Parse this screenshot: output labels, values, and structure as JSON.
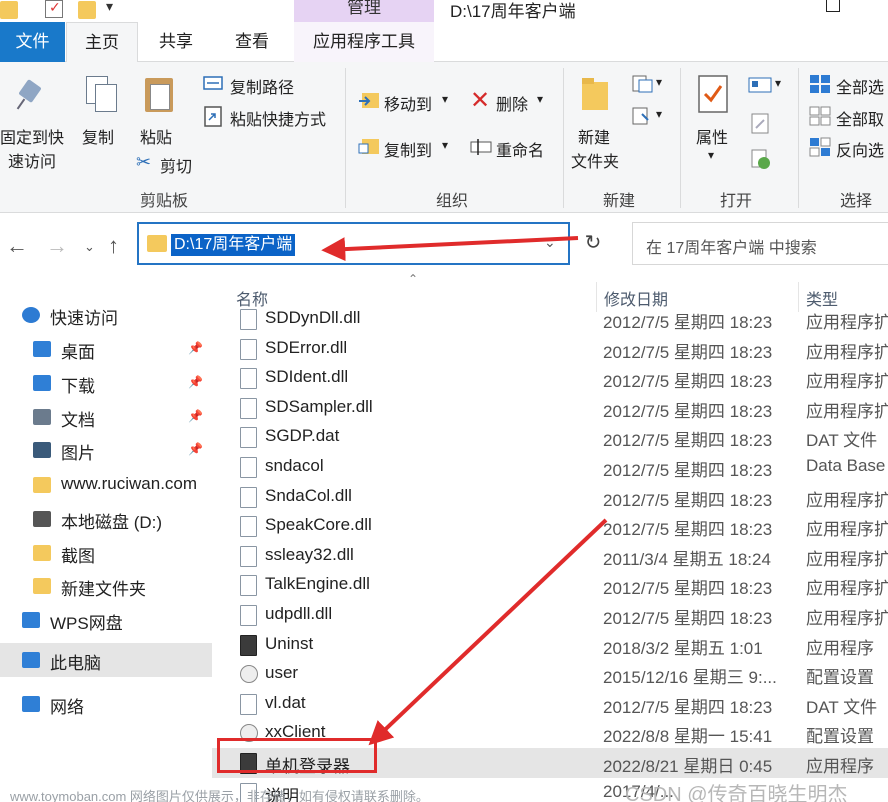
{
  "titlebar": {
    "manage_tab": "管理",
    "path_title": "D:\\17周年客户端"
  },
  "tabs": {
    "file": "文件",
    "home": "主页",
    "share": "共享",
    "view": "查看",
    "app_tools": "应用程序工具"
  },
  "ribbon": {
    "pin_line1": "固定到快",
    "pin_line2": "速访问",
    "copy": "复制",
    "paste": "粘贴",
    "copy_path": "复制路径",
    "paste_shortcut": "粘贴快捷方式",
    "cut": "剪切",
    "group_clipboard": "剪贴板",
    "move_to": "移动到",
    "copy_to": "复制到",
    "delete": "删除",
    "rename": "重命名",
    "group_organize": "组织",
    "new_folder_line1": "新建",
    "new_folder_line2": "文件夹",
    "group_new": "新建",
    "properties": "属性",
    "group_open": "打开",
    "select_all": "全部选",
    "select_none": "全部取",
    "invert_select": "反向选",
    "group_select": "选择"
  },
  "nav": {
    "address": "D:\\17周年客户端",
    "search_placeholder": "在 17周年客户端 中搜索"
  },
  "sidebar": {
    "items": [
      {
        "label": "快速访问",
        "icon": "star-icon",
        "color": "#2d7bd3"
      },
      {
        "label": "桌面",
        "icon": "desktop-icon",
        "color": "#2f7fd6"
      },
      {
        "label": "下载",
        "icon": "download-icon",
        "color": "#2f7fd6"
      },
      {
        "label": "文档",
        "icon": "document-icon",
        "color": "#6b7b8d"
      },
      {
        "label": "图片",
        "icon": "pictures-icon",
        "color": "#3a5a7a"
      },
      {
        "label": "www.ruciwan.com",
        "icon": "folder-icon",
        "color": "#f4c95d"
      },
      {
        "label": "本地磁盘 (D:)",
        "icon": "drive-icon",
        "color": "#555"
      },
      {
        "label": "截图",
        "icon": "folder-icon",
        "color": "#f4c95d"
      },
      {
        "label": "新建文件夹",
        "icon": "folder-icon",
        "color": "#f4c95d"
      },
      {
        "label": "WPS网盘",
        "icon": "cloud-icon",
        "color": "#2f7fd6"
      },
      {
        "label": "此电脑",
        "icon": "computer-icon",
        "color": "#2f7fd6"
      },
      {
        "label": "网络",
        "icon": "network-icon",
        "color": "#2f7fd6"
      }
    ]
  },
  "list": {
    "headers": {
      "name": "名称",
      "date": "修改日期",
      "type": "类型"
    },
    "rows": [
      {
        "name": "SDDynDll.dll",
        "date": "2012/7/5 星期四 18:23",
        "type": "应用程序扩",
        "icon": "dll"
      },
      {
        "name": "SDError.dll",
        "date": "2012/7/5 星期四 18:23",
        "type": "应用程序扩",
        "icon": "dll"
      },
      {
        "name": "SDIdent.dll",
        "date": "2012/7/5 星期四 18:23",
        "type": "应用程序扩",
        "icon": "dll"
      },
      {
        "name": "SDSampler.dll",
        "date": "2012/7/5 星期四 18:23",
        "type": "应用程序扩",
        "icon": "dll"
      },
      {
        "name": "SGDP.dat",
        "date": "2012/7/5 星期四 18:23",
        "type": "DAT 文件",
        "icon": "file"
      },
      {
        "name": "sndacol",
        "date": "2012/7/5 星期四 18:23",
        "type": "Data Base",
        "icon": "dll"
      },
      {
        "name": "SndaCol.dll",
        "date": "2012/7/5 星期四 18:23",
        "type": "应用程序扩",
        "icon": "dll"
      },
      {
        "name": "SpeakCore.dll",
        "date": "2012/7/5 星期四 18:23",
        "type": "应用程序扩",
        "icon": "dll"
      },
      {
        "name": "ssleay32.dll",
        "date": "2011/3/4 星期五 18:24",
        "type": "应用程序扩",
        "icon": "dll"
      },
      {
        "name": "TalkEngine.dll",
        "date": "2012/7/5 星期四 18:23",
        "type": "应用程序扩",
        "icon": "dll"
      },
      {
        "name": "udpdll.dll",
        "date": "2012/7/5 星期四 18:23",
        "type": "应用程序扩",
        "icon": "dll"
      },
      {
        "name": "Uninst",
        "date": "2018/3/2 星期五 1:01",
        "type": "应用程序",
        "icon": "exe"
      },
      {
        "name": "user",
        "date": "2015/12/16 星期三 9:...",
        "type": "配置设置",
        "icon": "gear"
      },
      {
        "name": "vl.dat",
        "date": "2012/7/5 星期四 18:23",
        "type": "DAT 文件",
        "icon": "file"
      },
      {
        "name": "xxClient",
        "date": "2022/8/8 星期一 15:41",
        "type": "配置设置",
        "icon": "gear"
      },
      {
        "name": "单机登录器",
        "date": "2022/8/21 星期日 0:45",
        "type": "应用程序",
        "icon": "exe"
      },
      {
        "name": "说明",
        "date": "2017/4/...",
        "type": "",
        "icon": "file"
      }
    ]
  },
  "watermark": {
    "left": "www.toymoban.com 网络图片仅供展示，非存储，如有侵权请联系删除。",
    "right": "CSDN @传奇百晓生明杰"
  },
  "colors": {
    "accent": "#1979ca",
    "annotation": "#e02b2b",
    "manage_tab": "#e6d3f3"
  }
}
